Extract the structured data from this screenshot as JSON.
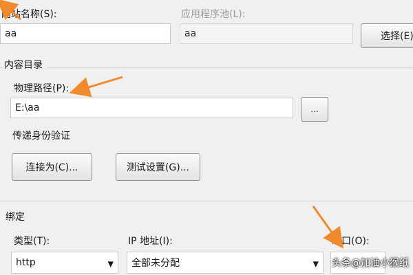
{
  "site": {
    "name_label": "网站名称(S):",
    "name_value": "aa",
    "pool_label": "应用程序池(L):",
    "pool_value": "aa",
    "select_button": "选择(E)"
  },
  "content_dir": {
    "title": "内容目录",
    "physical_path_label": "物理路径(P):",
    "physical_path_value": "E:\\aa",
    "browse_button": "...",
    "passthrough_label": "传递身份验证",
    "connect_as_button": "连接为(C)...",
    "test_settings_button": "测试设置(G)..."
  },
  "binding": {
    "title": "绑定",
    "type_label": "类型(T):",
    "type_value": "http",
    "ip_label": "IP 地址(I):",
    "ip_value": "全部未分配",
    "port_label": "端口(O):",
    "port_value": ""
  },
  "overlay": {
    "watermark": "头条@加油小猴纸",
    "arrow_color": "#f08a2c"
  }
}
